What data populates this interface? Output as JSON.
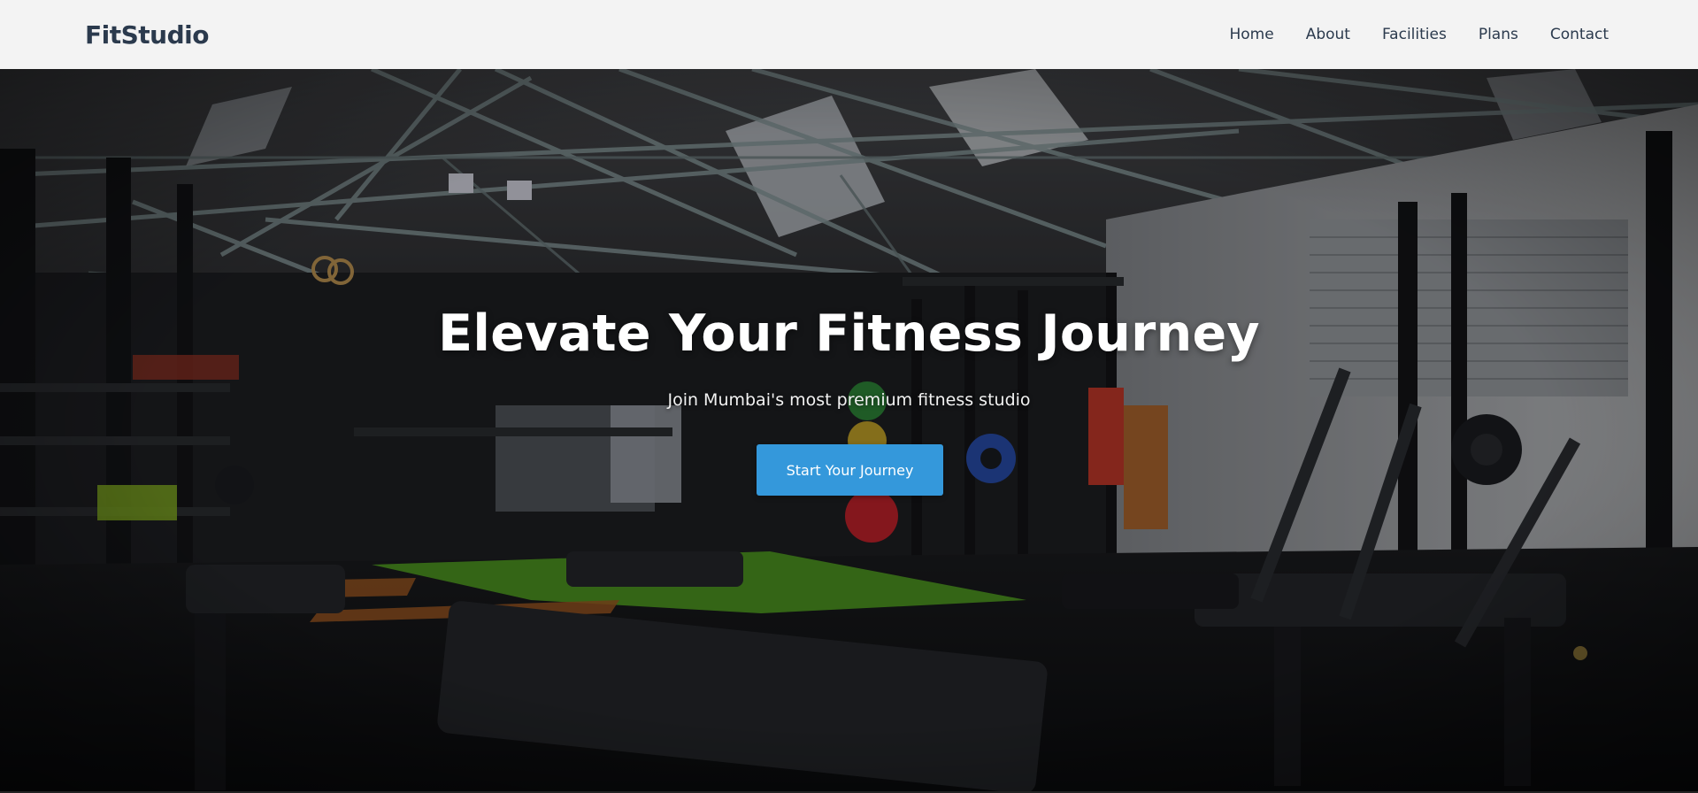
{
  "header": {
    "brand": "FitStudio",
    "nav": [
      {
        "label": "Home"
      },
      {
        "label": "About"
      },
      {
        "label": "Facilities"
      },
      {
        "label": "Plans"
      },
      {
        "label": "Contact"
      }
    ]
  },
  "hero": {
    "title": "Elevate Your Fitness Journey",
    "subtitle": "Join Mumbai's most premium fitness studio",
    "cta_label": "Start Your Journey",
    "background_image": "gym-interior-photo"
  },
  "colors": {
    "header_bg": "#f3f3f3",
    "brand_text": "#2b3a4d",
    "cta_bg": "#3498db",
    "cta_text": "#ffffff",
    "hero_text": "#ffffff"
  }
}
